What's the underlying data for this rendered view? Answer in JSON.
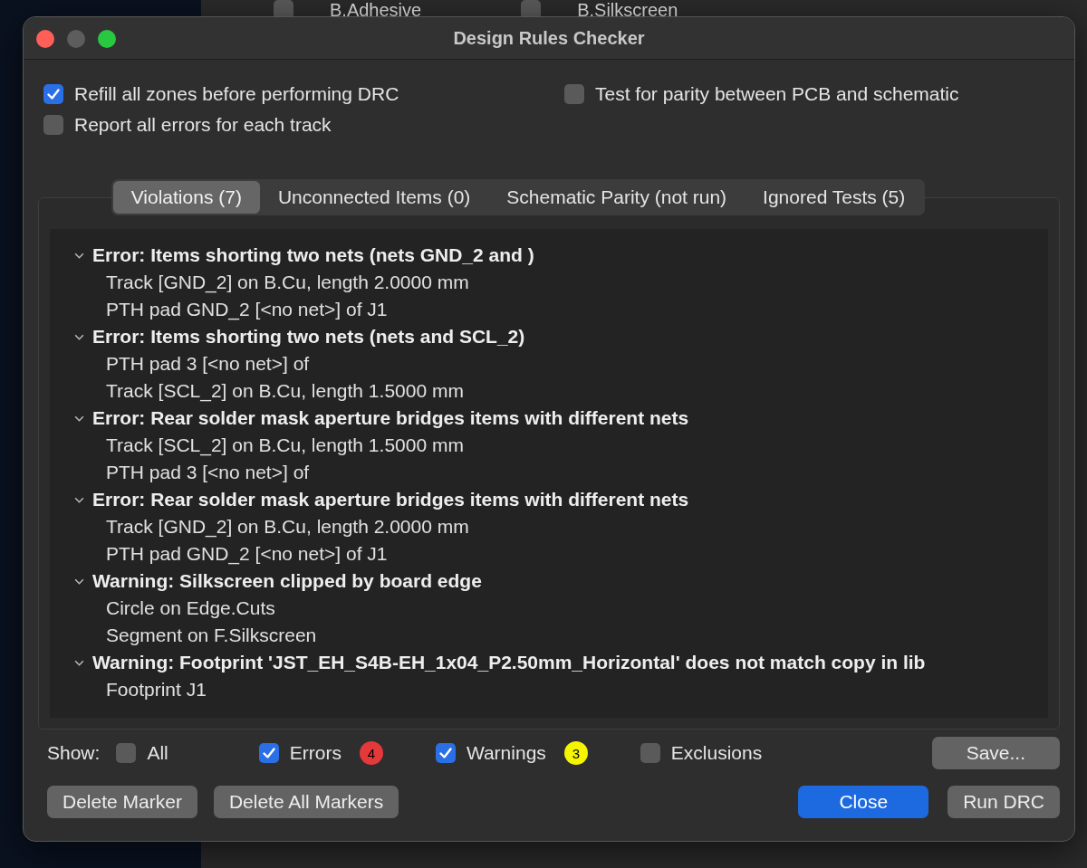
{
  "background_app": {
    "layers": [
      {
        "label": "B.Adhesive",
        "checked": false
      },
      {
        "label": "B.Silkscreen",
        "checked": false
      }
    ]
  },
  "window": {
    "title": "Design Rules Checker"
  },
  "options": [
    {
      "label": "Refill all zones before performing DRC",
      "checked": true
    },
    {
      "label": "Test for parity between PCB and schematic",
      "checked": false
    },
    {
      "label": "Report all errors for each track",
      "checked": false
    }
  ],
  "tabs": [
    {
      "label": "Violations (7)",
      "selected": true
    },
    {
      "label": "Unconnected Items (0)",
      "selected": false
    },
    {
      "label": "Schematic Parity (not run)",
      "selected": false
    },
    {
      "label": "Ignored Tests (5)",
      "selected": false
    }
  ],
  "violations": [
    {
      "title": "Error: Items shorting two nets (nets GND_2 and )",
      "expanded": true,
      "children": [
        "Track [GND_2] on B.Cu, length 2.0000 mm",
        "PTH pad GND_2 [<no net>] of J1"
      ]
    },
    {
      "title": "Error: Items shorting two nets (nets  and SCL_2)",
      "expanded": true,
      "children": [
        "PTH pad 3 [<no net>] of",
        "Track [SCL_2] on B.Cu, length 1.5000 mm"
      ]
    },
    {
      "title": "Error: Rear solder mask aperture bridges items with different nets",
      "expanded": true,
      "children": [
        "Track [SCL_2] on B.Cu, length 1.5000 mm",
        "PTH pad 3 [<no net>] of"
      ]
    },
    {
      "title": "Error: Rear solder mask aperture bridges items with different nets",
      "expanded": true,
      "children": [
        "Track [GND_2] on B.Cu, length 2.0000 mm",
        "PTH pad GND_2 [<no net>] of J1"
      ]
    },
    {
      "title": "Warning: Silkscreen clipped by board edge",
      "expanded": true,
      "children": [
        "Circle on Edge.Cuts",
        "Segment on F.Silkscreen"
      ]
    },
    {
      "title": "Warning: Footprint 'JST_EH_S4B-EH_1x04_P2.50mm_Horizontal' does not match copy in lib",
      "expanded": true,
      "children": [
        "Footprint J1"
      ]
    }
  ],
  "show": {
    "label": "Show:",
    "filters": [
      {
        "label": "All",
        "checked": false
      },
      {
        "label": "Errors",
        "checked": true,
        "count": "4",
        "color": "#e5383b"
      },
      {
        "label": "Warnings",
        "checked": true,
        "count": "3",
        "color": "#f5f500"
      },
      {
        "label": "Exclusions",
        "checked": false
      }
    ],
    "save_button": "Save..."
  },
  "buttons": [
    {
      "label": "Delete Marker",
      "kind": "plain"
    },
    {
      "label": "Delete All Markers",
      "kind": "plain"
    },
    {
      "label": "Close",
      "kind": "default"
    },
    {
      "label": "Run DRC",
      "kind": "plain"
    }
  ]
}
